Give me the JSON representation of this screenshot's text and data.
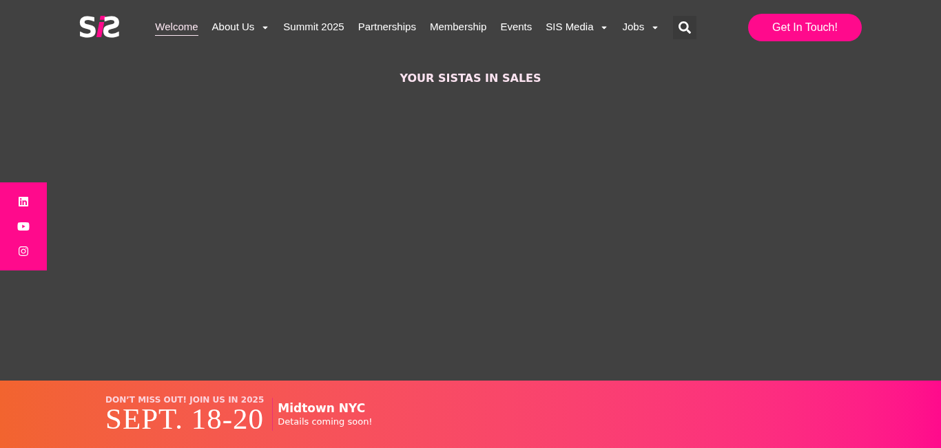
{
  "header": {
    "logo": "SiS",
    "nav": [
      {
        "label": "Welcome",
        "selected": true,
        "dropdown": false
      },
      {
        "label": "About Us",
        "selected": false,
        "dropdown": true
      },
      {
        "label": "Summit 2025",
        "selected": false,
        "dropdown": false
      },
      {
        "label": "Partnerships",
        "selected": false,
        "dropdown": false
      },
      {
        "label": "Membership",
        "selected": false,
        "dropdown": false
      },
      {
        "label": "Events",
        "selected": false,
        "dropdown": false
      },
      {
        "label": "SIS Media",
        "selected": false,
        "dropdown": true
      },
      {
        "label": "Jobs",
        "selected": false,
        "dropdown": true
      }
    ],
    "cta": "Get In Touch!"
  },
  "hero": {
    "title": "YOUR SISTAS IN SALES"
  },
  "banner": {
    "eyebrow": "DON’T MISS OUT! JOIN US IN 2025",
    "dates": "SEPT. 18-20",
    "location": "Midtown NYC",
    "note": "Details coming soon!"
  }
}
